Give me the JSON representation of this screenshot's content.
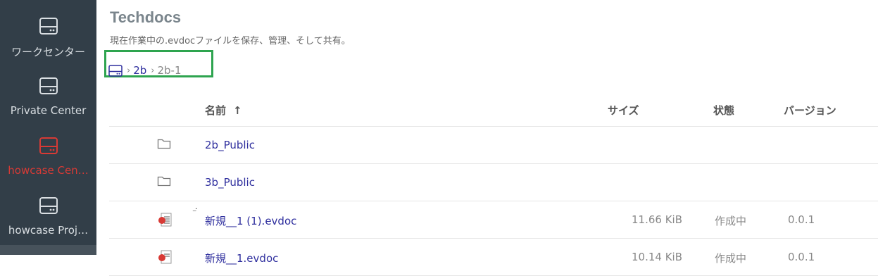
{
  "sidebar": {
    "items": [
      {
        "label": "ワークセンター",
        "icon": "drive-icon"
      },
      {
        "label": "Private Center",
        "icon": "drive-icon"
      },
      {
        "label": "howcase Cen…",
        "icon": "drive-icon",
        "active": true
      },
      {
        "label": "howcase Proj…",
        "icon": "drive-icon"
      }
    ]
  },
  "header": {
    "title": "Techdocs",
    "description": "現在作業中の.evdocファイルを保存、管理、そして共有。"
  },
  "breadcrumb": {
    "root_icon": "drive-icon",
    "items": [
      "2b",
      "2b-1"
    ]
  },
  "table": {
    "columns": {
      "name": "名前",
      "sort_indicator": "↑",
      "size": "サイズ",
      "status": "状態",
      "version": "バージョン"
    },
    "rows": [
      {
        "type": "folder",
        "icon": "folder-icon",
        "name": "2b_Public",
        "size": "",
        "status": "",
        "version": ""
      },
      {
        "type": "folder",
        "icon": "folder-icon",
        "name": "3b_Public",
        "size": "",
        "status": "",
        "version": ""
      },
      {
        "type": "file",
        "icon": "evdoc-file-icon",
        "name": "新規__1 (1).evdoc",
        "size": "11.66 KiB",
        "status": "作成中",
        "version": "0.0.1"
      },
      {
        "type": "file",
        "icon": "evdoc-file-icon",
        "name": "新規__1.evdoc",
        "size": "10.14 KiB",
        "status": "作成中",
        "version": "0.0.1"
      }
    ]
  },
  "colors": {
    "sidebar_bg": "#323e48",
    "active": "#d83a35",
    "link": "#2f2f9e",
    "highlight_box": "#2ea44f"
  }
}
